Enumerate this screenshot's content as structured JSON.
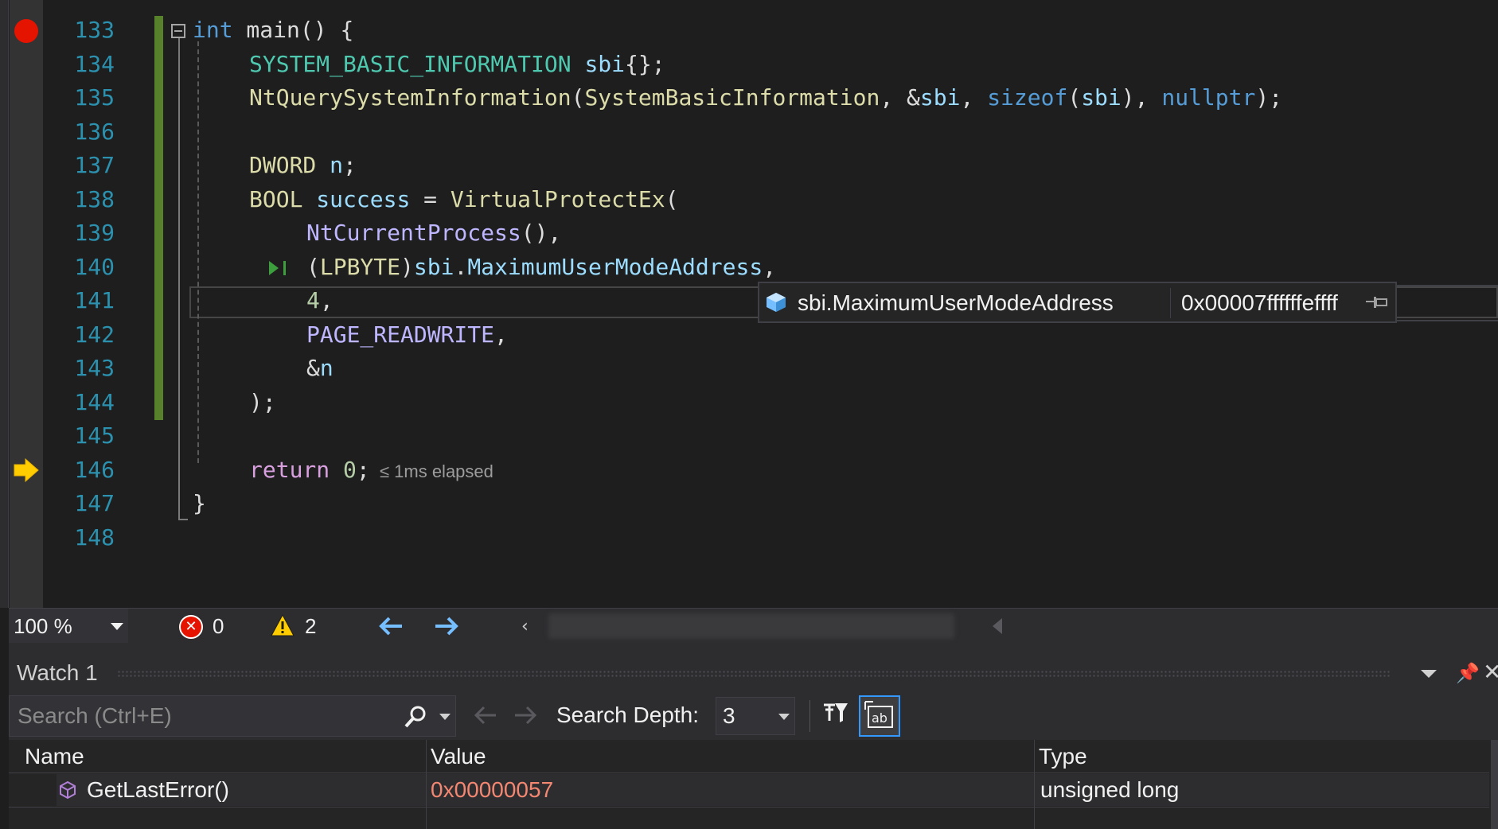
{
  "editor": {
    "lines": [
      {
        "num": "133",
        "tokens": [
          {
            "t": "int",
            "c": "kw"
          },
          {
            "t": " main() {",
            "c": "plain"
          }
        ]
      },
      {
        "num": "134",
        "tokens": [
          {
            "t": "SYSTEM_BASIC_INFORMATION",
            "c": "type"
          },
          {
            "t": " ",
            "c": "plain"
          },
          {
            "t": "sbi",
            "c": "var"
          },
          {
            "t": "{};",
            "c": "plain"
          }
        ]
      },
      {
        "num": "135",
        "tokens": [
          {
            "t": "NtQuerySystemInformation",
            "c": "fn"
          },
          {
            "t": "(",
            "c": "plain"
          },
          {
            "t": "SystemBasicInformation",
            "c": "fn"
          },
          {
            "t": ", &",
            "c": "plain"
          },
          {
            "t": "sbi",
            "c": "var"
          },
          {
            "t": ", ",
            "c": "plain"
          },
          {
            "t": "sizeof",
            "c": "kw"
          },
          {
            "t": "(",
            "c": "plain"
          },
          {
            "t": "sbi",
            "c": "var"
          },
          {
            "t": "), ",
            "c": "plain"
          },
          {
            "t": "nullptr",
            "c": "kw"
          },
          {
            "t": ");",
            "c": "plain"
          }
        ]
      },
      {
        "num": "136",
        "tokens": []
      },
      {
        "num": "137",
        "tokens": [
          {
            "t": "DWORD",
            "c": "fn"
          },
          {
            "t": " ",
            "c": "plain"
          },
          {
            "t": "n",
            "c": "var"
          },
          {
            "t": ";",
            "c": "plain"
          }
        ]
      },
      {
        "num": "138",
        "tokens": [
          {
            "t": "BOOL",
            "c": "fn"
          },
          {
            "t": " ",
            "c": "plain"
          },
          {
            "t": "success",
            "c": "var"
          },
          {
            "t": " = ",
            "c": "plain"
          },
          {
            "t": "VirtualProtectEx",
            "c": "fn"
          },
          {
            "t": "(",
            "c": "plain"
          }
        ]
      },
      {
        "num": "139",
        "tokens": [
          {
            "t": "NtCurrentProcess",
            "c": "macro"
          },
          {
            "t": "(),",
            "c": "plain"
          }
        ]
      },
      {
        "num": "140",
        "tokens": [
          {
            "t": "(",
            "c": "plain"
          },
          {
            "t": "LPBYTE",
            "c": "fn"
          },
          {
            "t": ")",
            "c": "plain"
          },
          {
            "t": "sbi",
            "c": "var"
          },
          {
            "t": ".",
            "c": "plain"
          },
          {
            "t": "MaximumUserModeAddress",
            "c": "var"
          },
          {
            "t": ",",
            "c": "plain"
          }
        ]
      },
      {
        "num": "141",
        "tokens": [
          {
            "t": "4",
            "c": "num"
          },
          {
            "t": ",",
            "c": "plain"
          }
        ]
      },
      {
        "num": "142",
        "tokens": [
          {
            "t": "PAGE_READWRITE",
            "c": "macro"
          },
          {
            "t": ",",
            "c": "plain"
          }
        ]
      },
      {
        "num": "143",
        "tokens": [
          {
            "t": "&",
            "c": "plain"
          },
          {
            "t": "n",
            "c": "var"
          }
        ]
      },
      {
        "num": "144",
        "tokens": [
          {
            "t": ");",
            "c": "plain"
          }
        ]
      },
      {
        "num": "145",
        "tokens": []
      },
      {
        "num": "146",
        "tokens": [
          {
            "t": "return",
            "c": "ctrl"
          },
          {
            "t": " ",
            "c": "plain"
          },
          {
            "t": "0",
            "c": "num"
          },
          {
            "t": ";",
            "c": "plain"
          },
          {
            "t": "  ≤ 1ms elapsed",
            "c": "hint"
          }
        ]
      },
      {
        "num": "147",
        "tokens": [
          {
            "t": "}",
            "c": "plain"
          }
        ]
      },
      {
        "num": "148",
        "tokens": []
      }
    ],
    "datatip": {
      "name": "sbi.MaximumUserModeAddress",
      "value": "0x00007ffffffeffff"
    }
  },
  "status_bar": {
    "zoom": "100 %",
    "errors": "0",
    "warnings": "2"
  },
  "watch": {
    "title": "Watch 1",
    "search_placeholder": "Search (Ctrl+E)",
    "search_depth_label": "Search Depth:",
    "search_depth_value": "3",
    "columns": {
      "name": "Name",
      "value": "Value",
      "type": "Type"
    },
    "rows": [
      {
        "name": "GetLastError()",
        "value": "0x00000057",
        "type": "unsigned long"
      }
    ]
  }
}
